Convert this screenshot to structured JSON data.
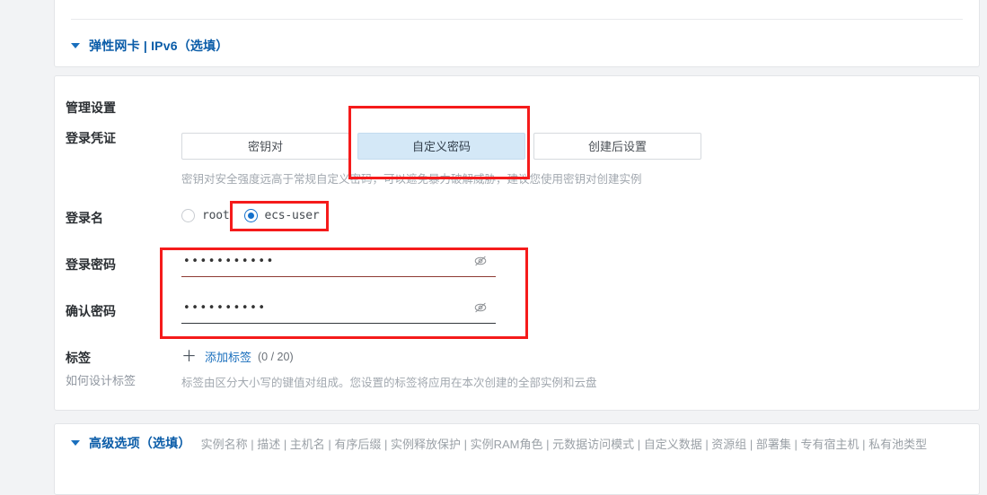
{
  "page": {
    "background_color": "#f2f3f5"
  },
  "sections": {
    "eni": {
      "title": "弹性网卡 | IPv6",
      "optional_suffix": "（选填）",
      "caret": "collapsed-caret",
      "full_title": "弹性网卡 | IPv6（选填）"
    },
    "management": {
      "title": "管理设置"
    },
    "advanced": {
      "title": "高级选项（选填）",
      "summary": "实例名称 | 描述 | 主机名 | 有序后缀 | 实例释放保护 | 实例RAM角色 | 元数据访问模式 | 自定义数据 | 资源组 | 部署集 | 专有宿主机 | 私有池类型"
    }
  },
  "credentials": {
    "label": "登录凭证",
    "options": [
      {
        "label": "密钥对",
        "selected": false
      },
      {
        "label": "自定义密码",
        "selected": true
      },
      {
        "label": "创建后设置",
        "selected": false
      }
    ],
    "helper": "密钥对安全强度远高于常规自定义密码，可以遮免暴力破解威胁，建议您使用密钥对创建实例"
  },
  "login_name": {
    "label": "登录名",
    "options": [
      {
        "label": "root",
        "selected": false
      },
      {
        "label": "ecs-user",
        "selected": true
      }
    ]
  },
  "password": {
    "label": "登录密码",
    "value": "•••••••••••",
    "toggle_icon": "eye-slash-icon",
    "underline_color": "#8d3a33"
  },
  "confirm_password": {
    "label": "确认密码",
    "value": "••••••••••",
    "toggle_icon": "eye-slash-icon",
    "underline_color": "#33383d"
  },
  "tags": {
    "label": "标签",
    "design_link": "如何设计标签",
    "add_label": "添加标签",
    "count": "(0 / 20)",
    "description": "标签由区分大小写的键值对组成。您设置的标签将应用在本次创建的全部实例和云盘"
  },
  "annotations": {
    "color": "#f51b1b",
    "boxes": [
      {
        "name": "custom-password-tab-highlight"
      },
      {
        "name": "ecs-user-radio-highlight"
      },
      {
        "name": "password-fields-highlight"
      }
    ]
  }
}
